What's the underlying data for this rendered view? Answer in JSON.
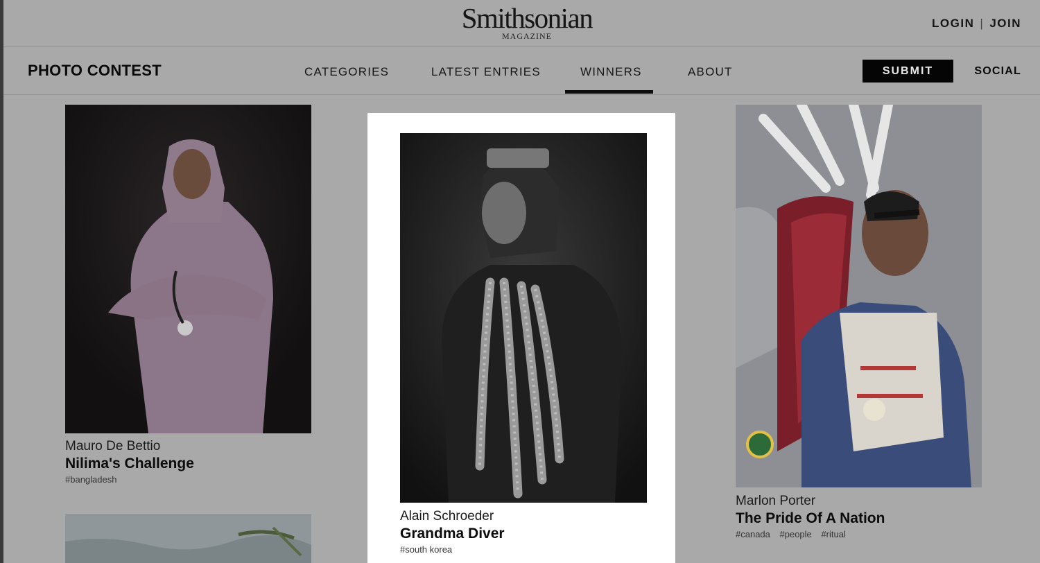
{
  "masthead": {
    "logo_main": "Smithsonian",
    "logo_sub": "MAGAZINE",
    "login_label": "LOGIN",
    "separator": "|",
    "join_label": "JOIN"
  },
  "contest_nav": {
    "title": "PHOTO CONTEST",
    "links": [
      "CATEGORIES",
      "LATEST ENTRIES",
      "WINNERS",
      "ABOUT"
    ],
    "active_link": "WINNERS",
    "submit_label": "SUBMIT",
    "social_label": "SOCIAL"
  },
  "entries": [
    {
      "author": "Mauro De Bettio",
      "title": "Nilima's Challenge",
      "tags": [
        "#bangladesh"
      ]
    },
    {
      "author": "Alain Schroeder",
      "title": "Grandma Diver",
      "tags": [
        "#south korea"
      ]
    },
    {
      "author": "Marlon Porter",
      "title": "The Pride Of A Nation",
      "tags": [
        "#canada",
        "#people",
        "#ritual"
      ]
    }
  ],
  "colors": {
    "overlay_background": "#a9a9a9",
    "submit_button": "#050505",
    "highlight_panel": "#ffffff"
  }
}
